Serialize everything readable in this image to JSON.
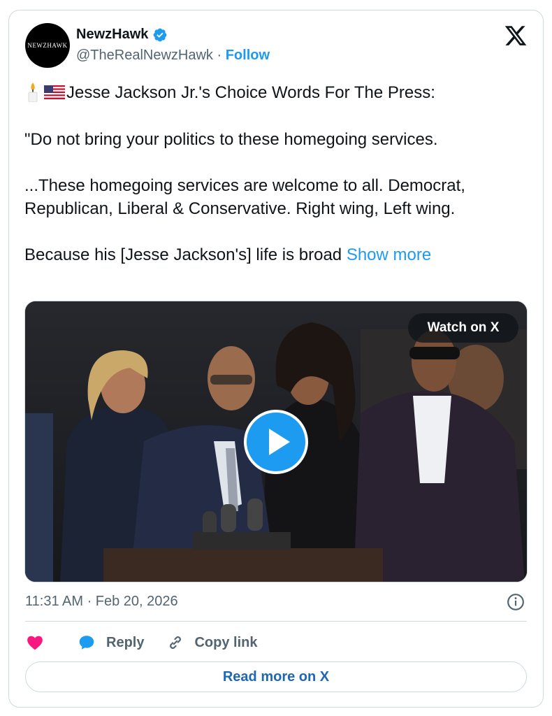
{
  "author": {
    "display_name": "NewzHawk",
    "handle": "@TheRealNewzHawk",
    "separator": "·",
    "follow_label": "Follow",
    "avatar_text": "NEWZHAWK"
  },
  "tweet": {
    "line1": "Jesse Jackson Jr.'s Choice Words For The Press:",
    "line2": "\"Do not bring your politics to these homegoing services.",
    "line3": "...These homegoing services are welcome to all. Democrat, Republican,  Liberal & Conservative. Right wing, Left wing.",
    "line4": "Because his [Jesse Jackson's] life is broad",
    "show_more_label": "Show more",
    "emojis": [
      "candle",
      "us-flag"
    ]
  },
  "media": {
    "watch_label": "Watch on X"
  },
  "meta": {
    "timestamp": "11:31 AM · Feb 20, 2026"
  },
  "actions": {
    "reply_label": "Reply",
    "copy_label": "Copy link"
  },
  "footer": {
    "read_more_label": "Read more on X"
  },
  "colors": {
    "accent": "#1d9bf0",
    "link_dark": "#1d67b5",
    "heart": "#f91880",
    "muted": "#536471",
    "border": "#cfd9de"
  }
}
